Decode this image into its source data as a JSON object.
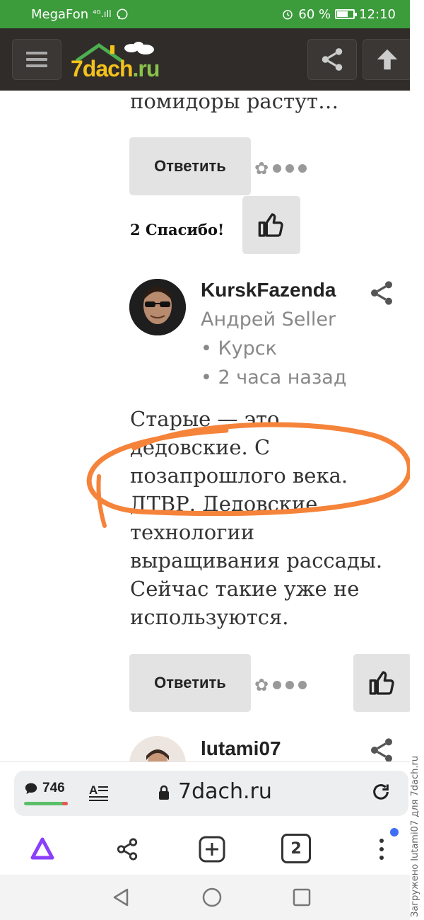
{
  "status_bar": {
    "carrier": "MegaFon",
    "signal_text": "⁴ᴳ.ıll",
    "battery_percent": "60 %",
    "time": "12:10"
  },
  "header": {
    "logo_main": "7dach",
    "logo_suffix": ".ru"
  },
  "content": {
    "previous_comment_tail": "помидоры растут…",
    "reply_label": "Ответить",
    "thanks_text": "2 Спасибо!",
    "comment": {
      "username": "KurskFazenda",
      "real_name": "Андрей Seller",
      "city": "• Курск",
      "time": "•  2 часа назад",
      "text_lines": [
        "Старые — это",
        "дедовские. С",
        "позапрошлого века.",
        "ДТВР. Дедовские",
        "технологии",
        "выращивания рассады.",
        "Сейчас такие уже не",
        "используются."
      ]
    },
    "reply_label_2": "Ответить",
    "next_username": "lutami07"
  },
  "browser": {
    "comment_count": "746",
    "url": "7dach.ru",
    "tab_count": "2"
  },
  "watermark": "Загружено lutami07 для 7dach.ru",
  "colors": {
    "status_green": "#3c9c3c",
    "header_dark": "#2f2c29",
    "logo_yellow": "#f3c21b",
    "logo_green": "#8bc34a",
    "annotation_orange": "#f5833a",
    "alice_purple": "#8a3ffc"
  },
  "icons": [
    "menu-icon",
    "share-icon",
    "arrow-up-icon",
    "thumbs-up-icon",
    "comment-icon",
    "reader-mode-icon",
    "lock-icon",
    "reload-icon",
    "alice-icon",
    "tabs-icon",
    "more-icon",
    "back-icon",
    "home-icon",
    "recents-icon"
  ]
}
